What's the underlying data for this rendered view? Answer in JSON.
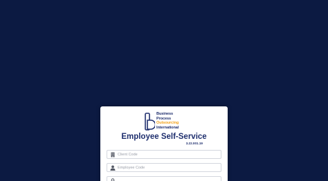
{
  "colors": {
    "background": "#0c1a42",
    "brand_navy": "#1f2f6e",
    "brand_orange": "#f2a21b"
  },
  "logo": {
    "line1": "Business",
    "line2": "Process",
    "line3": "Outsourcing",
    "line4": "International",
    "icon": "bpo-logo-mark"
  },
  "header": {
    "title": "Employee Self-Service",
    "version": "3.22.001.19"
  },
  "form": {
    "client_code": {
      "placeholder": "Client Code",
      "value": "",
      "icon": "building-icon"
    },
    "employee_code": {
      "placeholder": "Employee Code",
      "value": "",
      "icon": "user-icon"
    },
    "password": {
      "placeholder": "",
      "value": "",
      "icon": "lock-icon"
    }
  }
}
